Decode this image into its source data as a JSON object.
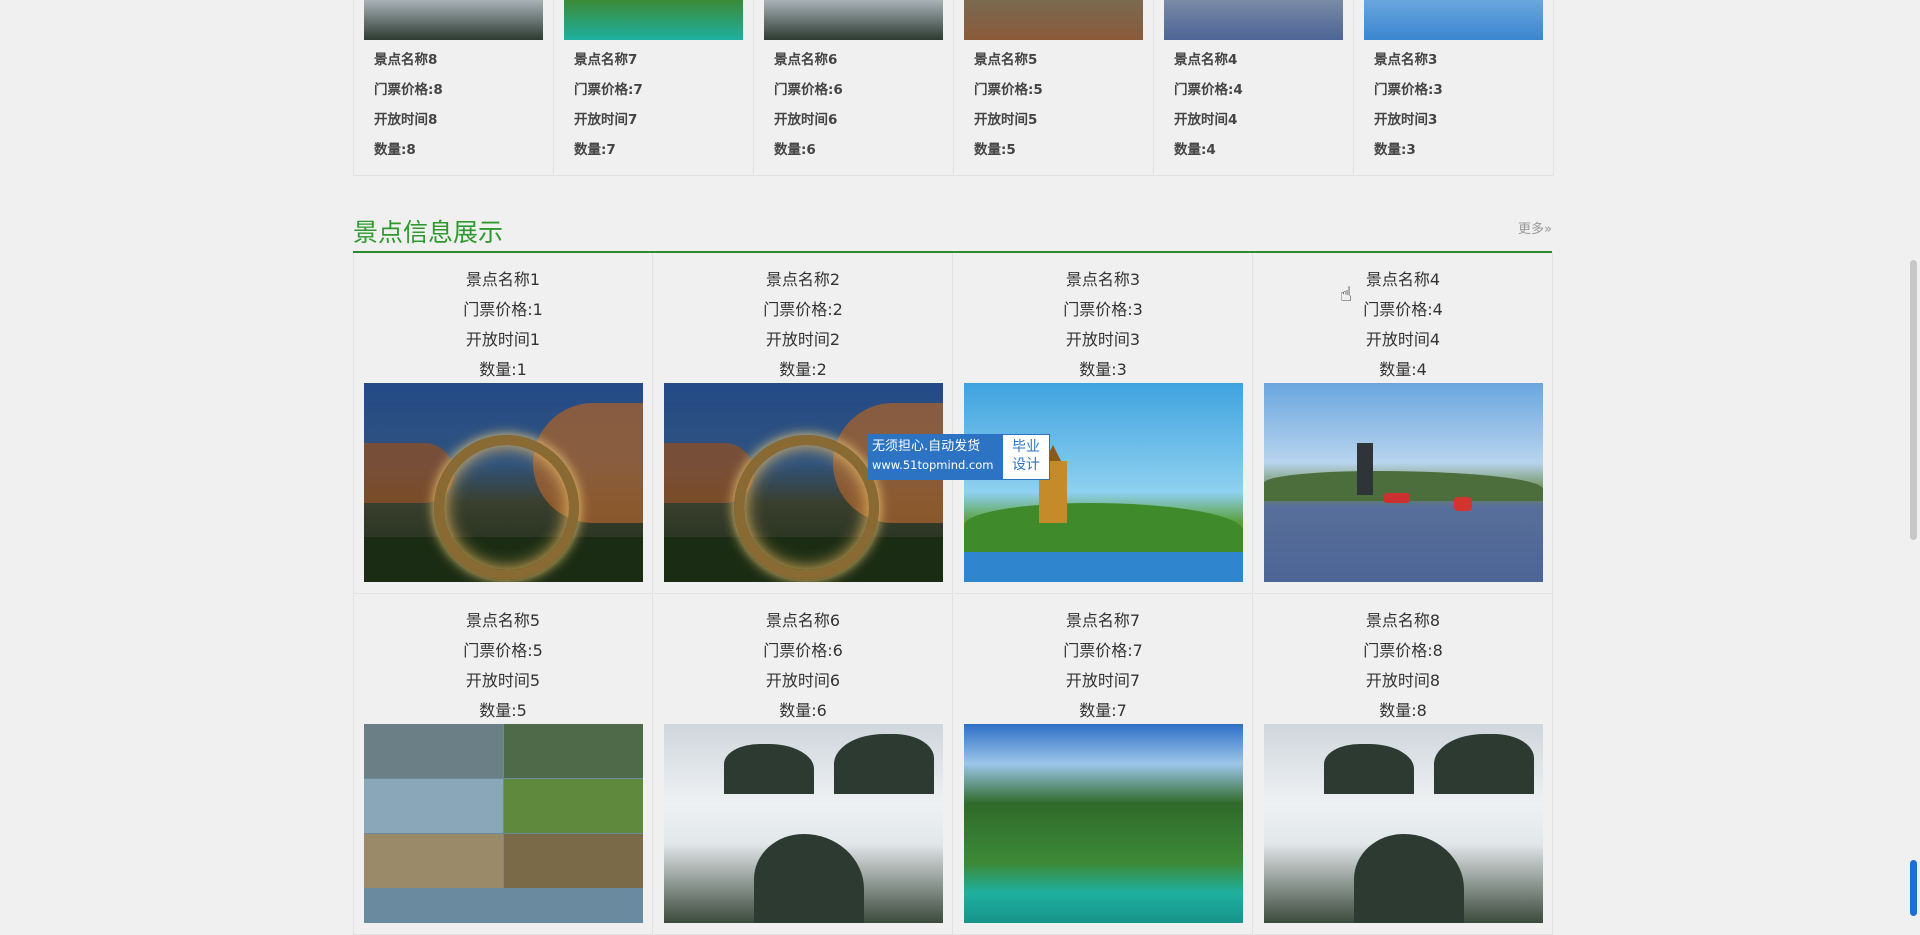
{
  "top_row": [
    {
      "name": "景点名称8",
      "price": "门票价格:8",
      "hours": "开放时间8",
      "qty": "数量:8"
    },
    {
      "name": "景点名称7",
      "price": "门票价格:7",
      "hours": "开放时间7",
      "qty": "数量:7"
    },
    {
      "name": "景点名称6",
      "price": "门票价格:6",
      "hours": "开放时间6",
      "qty": "数量:6"
    },
    {
      "name": "景点名称5",
      "price": "门票价格:5",
      "hours": "开放时间5",
      "qty": "数量:5"
    },
    {
      "name": "景点名称4",
      "price": "门票价格:4",
      "hours": "开放时间4",
      "qty": "数量:4"
    },
    {
      "name": "景点名称3",
      "price": "门票价格:3",
      "hours": "开放时间3",
      "qty": "数量:3"
    }
  ],
  "section": {
    "title": "景点信息展示",
    "more": "更多»"
  },
  "cards": [
    {
      "name": "景点名称1",
      "price": "门票价格:1",
      "hours": "开放时间1",
      "qty": "数量:1"
    },
    {
      "name": "景点名称2",
      "price": "门票价格:2",
      "hours": "开放时间2",
      "qty": "数量:2"
    },
    {
      "name": "景点名称3",
      "price": "门票价格:3",
      "hours": "开放时间3",
      "qty": "数量:3"
    },
    {
      "name": "景点名称4",
      "price": "门票价格:4",
      "hours": "开放时间4",
      "qty": "数量:4"
    },
    {
      "name": "景点名称5",
      "price": "门票价格:5",
      "hours": "开放时间5",
      "qty": "数量:5"
    },
    {
      "name": "景点名称6",
      "price": "门票价格:6",
      "hours": "开放时间6",
      "qty": "数量:6"
    },
    {
      "name": "景点名称7",
      "price": "门票价格:7",
      "hours": "开放时间7",
      "qty": "数量:7"
    },
    {
      "name": "景点名称8",
      "price": "门票价格:8",
      "hours": "开放时间8",
      "qty": "数量:8"
    }
  ],
  "watermark": {
    "line1": "无须担心.自动发货",
    "line2": "www.51topmind.com",
    "right1": "毕业",
    "right2": "设计"
  },
  "colors": {
    "accent": "#2e8b2e",
    "watermark_blue": "#2d73c4"
  }
}
